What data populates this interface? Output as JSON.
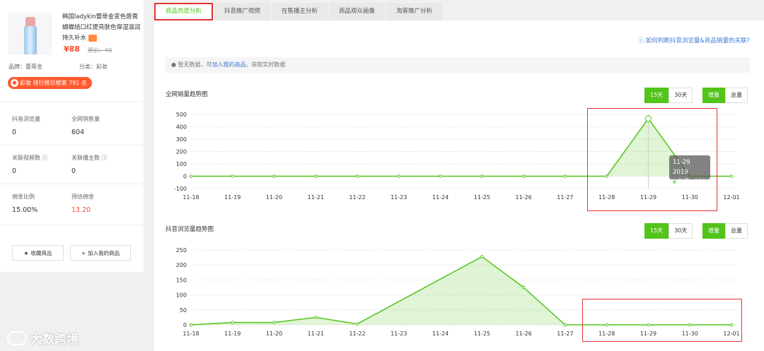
{
  "product": {
    "title": "韩国ladykin蕾蒂金变色唇膏蝴蝶结口红提亮肤色保湿滋润持久补水",
    "price": "¥88",
    "original_price": "原价：¥0",
    "brand": "品牌：蕾蒂金",
    "category": "分类：彩妆",
    "rank_badge": "彩妆 排行榜日榜第 791 名"
  },
  "stats": {
    "views_label": "抖音浏览量",
    "views_value": "0",
    "sales_label": "全网销售量",
    "sales_value": "604",
    "videos_label": "关联视频数 ⓘ",
    "videos_value": "0",
    "anchors_label": "关联播主数 ⓘ",
    "anchors_value": "0",
    "commission_label": "佣金比例",
    "commission_value": "15.00%",
    "est_label": "预估佣金",
    "est_value": "13.20"
  },
  "actions": {
    "collect": "收藏商品",
    "add": "加入我的商品"
  },
  "tabs": [
    "商品热度分析",
    "抖音推广视频",
    "在售播主分析",
    "商品观众画像",
    "淘客推广分析"
  ],
  "help_text": "如何判断抖音浏览量&商品销量的关联?",
  "notice": {
    "pre": "暂无数据，可",
    "link": "加入我的商品",
    "post": "，获取实时数据"
  },
  "chart1_title": "全网销量趋势图",
  "chart2_title": "抖音浏览量趋势图",
  "controls": {
    "d15": "15天",
    "d30": "30天",
    "inc": "增量",
    "total": "总量"
  },
  "tooltip": {
    "date": "11-29 2019",
    "value": "数量: 466"
  },
  "watermark": "大数跨境",
  "colors": {
    "accent": "#52c41a",
    "highlight": "#e53333",
    "price": "#ff4d2d"
  },
  "chart_data": [
    {
      "type": "area",
      "title": "全网销量趋势图",
      "x": [
        "11-18",
        "11-19",
        "11-20",
        "11-21",
        "11-22",
        "11-23",
        "11-24",
        "11-25",
        "11-26",
        "11-27",
        "11-28",
        "11-29",
        "11-30",
        "12-01"
      ],
      "values": [
        0,
        0,
        0,
        0,
        0,
        0,
        0,
        0,
        0,
        0,
        0,
        466,
        0,
        0
      ],
      "ylim": [
        -100,
        500
      ],
      "yticks": [
        -100,
        0,
        100,
        200,
        300,
        400,
        500
      ]
    },
    {
      "type": "area",
      "title": "抖音浏览量趋势图",
      "x": [
        "11-18",
        "11-19",
        "11-20",
        "11-21",
        "11-22",
        "11-23",
        "11-24",
        "11-25",
        "11-26",
        "11-27",
        "11-28",
        "11-29",
        "11-30",
        "12-01"
      ],
      "values": [
        0,
        8,
        8,
        25,
        3,
        null,
        null,
        228,
        125,
        0,
        0,
        0,
        0,
        0
      ],
      "ylim": [
        0,
        250
      ],
      "yticks": [
        0,
        50,
        100,
        150,
        200,
        250
      ]
    }
  ]
}
